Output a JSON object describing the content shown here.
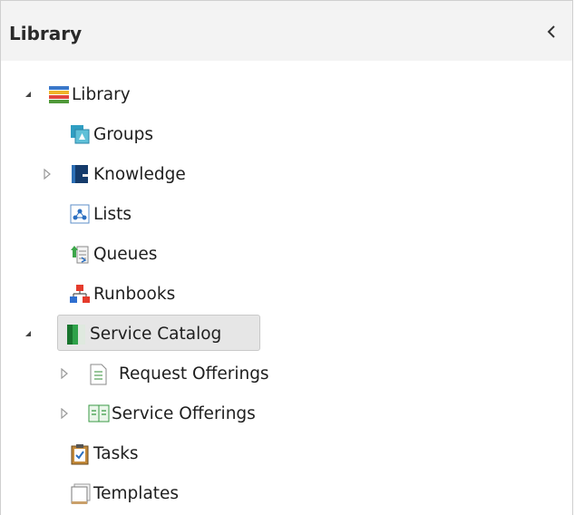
{
  "panel": {
    "title": "Library",
    "collapse_icon": "chevron-left-icon"
  },
  "tree": {
    "root": {
      "label": "Library",
      "expanded": true,
      "icon": "library-books-icon"
    },
    "items": [
      {
        "label": "Groups",
        "icon": "groups-icon"
      },
      {
        "label": "Knowledge",
        "icon": "knowledge-book-icon",
        "expandable": true
      },
      {
        "label": "Lists",
        "icon": "lists-icon"
      },
      {
        "label": "Queues",
        "icon": "queues-icon"
      },
      {
        "label": "Runbooks",
        "icon": "runbooks-icon"
      },
      {
        "label": "Service Catalog",
        "icon": "service-catalog-icon",
        "expanded": true,
        "selected": true,
        "children": [
          {
            "label": "Request Offerings",
            "icon": "request-offerings-icon",
            "expandable": true
          },
          {
            "label": "Service Offerings",
            "icon": "service-offerings-icon",
            "expandable": true
          }
        ]
      },
      {
        "label": "Tasks",
        "icon": "tasks-clipboard-icon"
      },
      {
        "label": "Templates",
        "icon": "templates-icon"
      }
    ]
  }
}
